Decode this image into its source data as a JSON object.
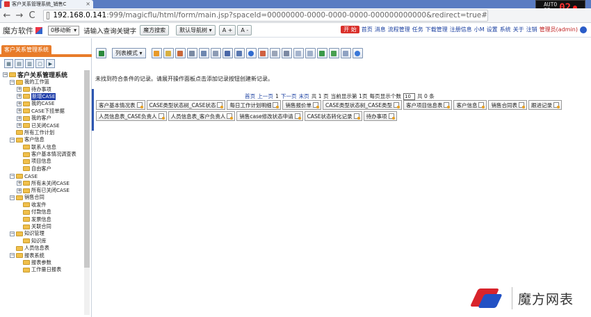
{
  "browser": {
    "tab_title": "客户关系管理系统_销售C",
    "tab_close": "×",
    "url_host": "192.168.0.141",
    "url_rest": ":999/magicflu/html/form/main.jsp?spaceId=00000000-0000-0000-0000-000000000000&redirect=true#",
    "clock_small_top": "AUTO",
    "clock_small_bottom": "03",
    "clock_big": "02"
  },
  "header": {
    "brand": "魔方软件",
    "status_select": "0移动新",
    "search_hint": "请输入查询关键字",
    "search_button": "魔方搜索",
    "quicknav_button": "默认导航树 ▾",
    "font_up": "A +",
    "font_down": "A -",
    "start": "开 始",
    "links": [
      "首页",
      "消息",
      "流程管理",
      "任务",
      "下载管理",
      "注册信息",
      "小M",
      "设置",
      "系统",
      "关于",
      "注销"
    ],
    "admin": "管理员(admin)"
  },
  "left": {
    "title": "客户关系管理系统",
    "tree": [
      {
        "level": 0,
        "pm": "−",
        "label": "客户关系管理系统",
        "root": true
      },
      {
        "level": 1,
        "pm": "−",
        "label": "我的工作篮"
      },
      {
        "level": 2,
        "pm": "+",
        "label": "待办事项"
      },
      {
        "level": 2,
        "pm": "+",
        "label": "新增CASE",
        "selected": true
      },
      {
        "level": 2,
        "pm": "+",
        "label": "我的CASE"
      },
      {
        "level": 2,
        "pm": "+",
        "label": "CASE下挂单据"
      },
      {
        "level": 2,
        "pm": "+",
        "label": "我的客户"
      },
      {
        "level": 2,
        "pm": "+",
        "label": "已关闭CASE"
      },
      {
        "level": 1,
        "pm": "",
        "label": "所有工作计划"
      },
      {
        "level": 1,
        "pm": "−",
        "label": "客户信息"
      },
      {
        "level": 2,
        "pm": "",
        "label": "联系人信息"
      },
      {
        "level": 2,
        "pm": "",
        "label": "客户基本情况调查表"
      },
      {
        "level": 2,
        "pm": "",
        "label": "项目信息"
      },
      {
        "level": 2,
        "pm": "",
        "label": "自由客户"
      },
      {
        "level": 1,
        "pm": "−",
        "label": "CASE"
      },
      {
        "level": 2,
        "pm": "+",
        "label": "所有未关闭CASE"
      },
      {
        "level": 2,
        "pm": "+",
        "label": "所有已关闭CASE"
      },
      {
        "level": 1,
        "pm": "−",
        "label": "销售合同"
      },
      {
        "level": 2,
        "pm": "",
        "label": "收发件"
      },
      {
        "level": 2,
        "pm": "",
        "label": "付款信息"
      },
      {
        "level": 2,
        "pm": "",
        "label": "发票信息"
      },
      {
        "level": 2,
        "pm": "",
        "label": "关联合同"
      },
      {
        "level": 1,
        "pm": "−",
        "label": "知识管理"
      },
      {
        "level": 2,
        "pm": "",
        "label": "知识库"
      },
      {
        "level": 1,
        "pm": "",
        "label": "人员信息表"
      },
      {
        "level": 1,
        "pm": "−",
        "label": "报表系统"
      },
      {
        "level": 2,
        "pm": "",
        "label": "报表参数"
      },
      {
        "level": 2,
        "pm": "",
        "label": "工作量日报表"
      }
    ]
  },
  "main": {
    "mode_button": "列表模式 ▾",
    "not_found": "未找到符合条件的记录。请展开操作面板点击添加记录按钮创建新记录。",
    "pager": {
      "first": "首页",
      "prev": "上一页",
      "current": "1",
      "next": "下一页",
      "last": "末页",
      "total_pages": "共 1 页",
      "current_info": "当前显示第 1页",
      "per_page_label": "每页显示个数",
      "per_page_value": "10",
      "total": "共 0 条"
    },
    "cards_row1": [
      "客户基本情况表",
      "CASE类型状态树_CASE状态",
      "每日工作计划明细",
      "销售报价单",
      "CASE类型状态树_CASE类型",
      "客户项目信息表",
      "客户信息",
      "销售合同表",
      "跟进记录"
    ],
    "cards_row2": [
      "人员信息表_CASE负责人",
      "人员信息表_客户负责人",
      "销售case修改状态申请",
      "CASE状态转化记录",
      "待办事项"
    ]
  },
  "watermark": "魔方网表",
  "colors": {
    "accent_orange": "#e87c2a",
    "link_blue": "#1a3fa0",
    "start_red": "#d9302b"
  }
}
